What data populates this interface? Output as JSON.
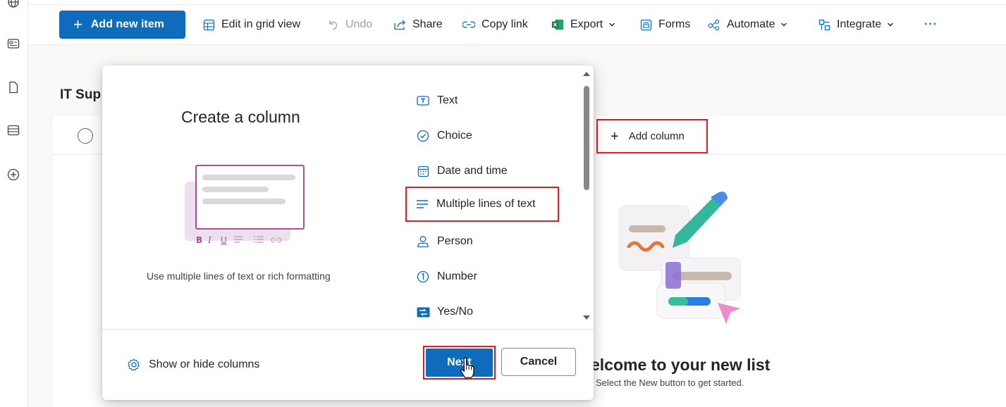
{
  "toolbar": {
    "add_new_item": "Add new item",
    "edit_grid": "Edit in grid view",
    "undo": "Undo",
    "share": "Share",
    "copy_link": "Copy link",
    "export": "Export",
    "forms": "Forms",
    "automate": "Automate",
    "integrate": "Integrate",
    "more": "···"
  },
  "list": {
    "title": "IT Sup",
    "add_column": "Add column",
    "welcome_title": "elcome to your new list",
    "welcome_sub": "Select the New button to get started."
  },
  "dialog": {
    "title": "Create a column",
    "description": "Use multiple lines of text or rich formatting",
    "types": [
      {
        "label": "Text",
        "icon": "text-box-icon"
      },
      {
        "label": "Choice",
        "icon": "circle-check-icon"
      },
      {
        "label": "Date and time",
        "icon": "calendar-icon"
      },
      {
        "label": "Multiple lines of text",
        "icon": "lines-icon",
        "selected": true
      },
      {
        "label": "Person",
        "icon": "person-icon"
      },
      {
        "label": "Number",
        "icon": "number-circle-icon"
      },
      {
        "label": "Yes/No",
        "icon": "toggle-icon"
      }
    ],
    "show_hide": "Show or hide columns",
    "next": "Next",
    "cancel": "Cancel"
  },
  "colors": {
    "primary": "#0f6cbd",
    "highlight": "#e21b22"
  }
}
